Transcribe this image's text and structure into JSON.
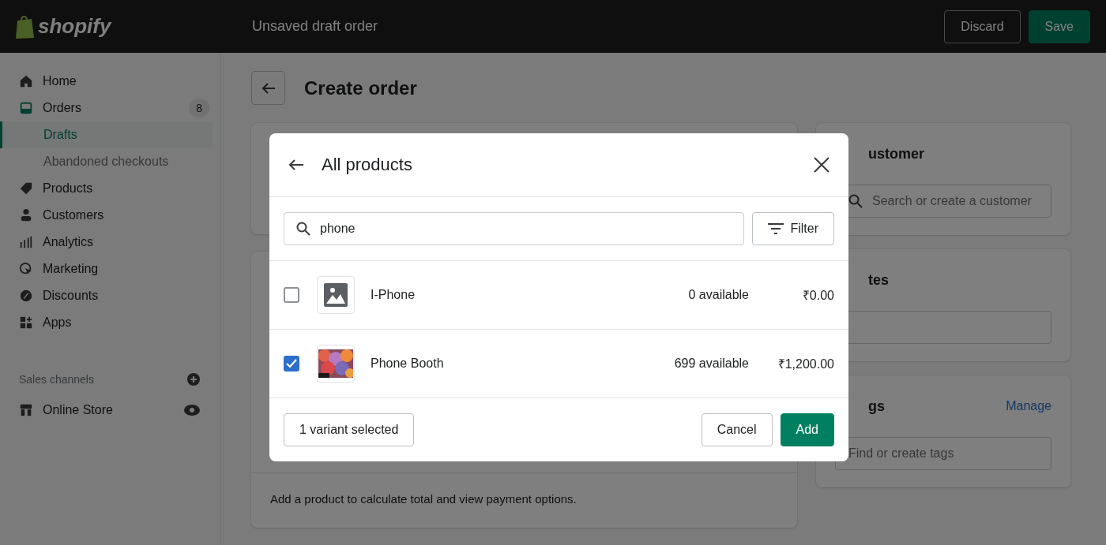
{
  "topbar": {
    "logo": "shopify",
    "title": "Unsaved draft order",
    "buttons": [
      {
        "label": "Discard",
        "kind": "secondary"
      },
      {
        "label": "Save",
        "kind": "primary"
      }
    ]
  },
  "sidebar": {
    "items": [
      {
        "label": "Home",
        "kind": "home",
        "selected": false
      },
      {
        "label": "Orders",
        "kind": "orders",
        "selected": false,
        "badge": "8",
        "children": [
          {
            "label": "Drafts",
            "selected": true
          },
          {
            "label": "Abandoned checkouts",
            "selected": false
          }
        ]
      },
      {
        "label": "Products",
        "kind": "tag",
        "selected": false
      },
      {
        "label": "Customers",
        "kind": "person",
        "selected": false
      },
      {
        "label": "Analytics",
        "kind": "bars",
        "selected": false
      },
      {
        "label": "Marketing",
        "kind": "target",
        "selected": false
      },
      {
        "label": "Discounts",
        "kind": "percent",
        "selected": false
      },
      {
        "label": "Apps",
        "kind": "apps",
        "selected": false
      }
    ],
    "sales_channels": {
      "heading": "Sales channels",
      "items": [
        {
          "label": "Online Store",
          "kind": "store",
          "selected": false
        }
      ]
    }
  },
  "page": {
    "title": "Create order",
    "payment_note": "Add a product to calculate total and view payment options."
  },
  "right_cards": [
    {
      "title": "ustomer",
      "field_placeholder": "Search or create a customer",
      "kind": "search"
    },
    {
      "title": "tes",
      "kind": "text"
    },
    {
      "title": "gs",
      "action": "Manage",
      "field_placeholder": "Find or create tags",
      "kind": "text"
    }
  ],
  "modal": {
    "title": "All products",
    "search": {
      "value": "phone"
    },
    "filter_label": "Filter",
    "rows": [
      {
        "name": "I-Phone",
        "available": "0 available",
        "price": "₹0.00",
        "checked": false,
        "kind": "placeholder"
      },
      {
        "name": "Phone Booth",
        "available": "699 available",
        "price": "₹1,200.00",
        "checked": true,
        "kind": "picture"
      }
    ],
    "selected_count": "1 variant selected",
    "cancel": "Cancel",
    "add": "Add"
  }
}
